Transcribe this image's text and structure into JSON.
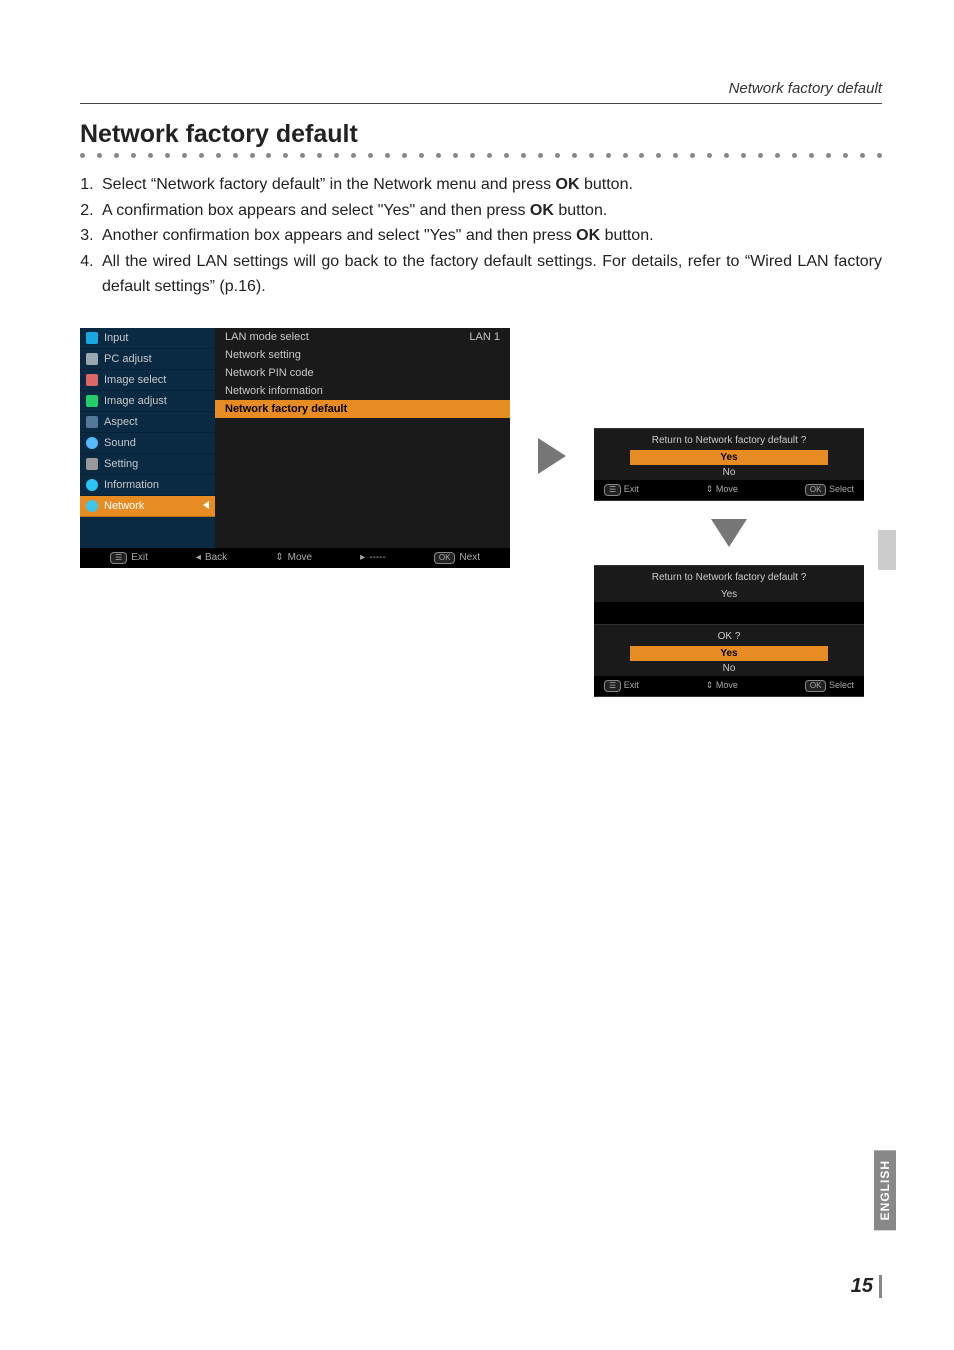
{
  "header": {
    "running": "Network factory default"
  },
  "title": "Network factory default",
  "steps": [
    {
      "pre": "Select “Network factory default” in the Network menu and press ",
      "bold": "OK",
      "post": " button."
    },
    {
      "pre": "A confirmation box appears and select \"Yes\" and then press ",
      "bold": "OK",
      "post": " button."
    },
    {
      "pre": "Another confirmation box appears and select \"Yes\" and then press ",
      "bold": "OK",
      "post": " button."
    },
    {
      "pre": "All the wired LAN settings will go back to the factory default settings. For details, refer to “Wired LAN factory default settings” (p.16).",
      "bold": "",
      "post": ""
    }
  ],
  "osd": {
    "left": [
      "Input",
      "PC adjust",
      "Image select",
      "Image adjust",
      "Aspect",
      "Sound",
      "Setting",
      "Information",
      "Network"
    ],
    "right": [
      {
        "label": "LAN mode select",
        "value": "LAN 1"
      },
      {
        "label": "Network setting",
        "value": ""
      },
      {
        "label": "Network PIN code",
        "value": ""
      },
      {
        "label": "Network information",
        "value": ""
      },
      {
        "label": "Network factory default",
        "value": ""
      }
    ],
    "foot": {
      "exit": "Exit",
      "back": "Back",
      "move": "Move",
      "dash": "-----",
      "next": "Next"
    }
  },
  "dialog1": {
    "question": "Return to Network factory default ?",
    "yes": "Yes",
    "no": "No",
    "foot": {
      "exit": "Exit",
      "move": "Move",
      "select": "Select"
    }
  },
  "dialog2": {
    "question": "Return to Network factory default ?",
    "yes1": "Yes",
    "ok": "OK ?",
    "yes2": "Yes",
    "no": "No",
    "foot": {
      "exit": "Exit",
      "move": "Move",
      "select": "Select"
    }
  },
  "lang": "ENGLISH",
  "pagenum": "15"
}
